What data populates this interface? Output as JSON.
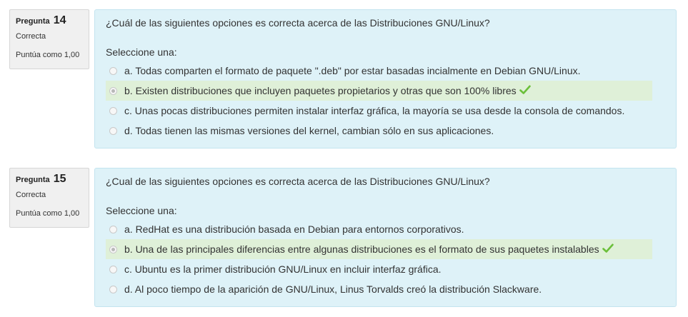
{
  "questions": [
    {
      "label": "Pregunta",
      "number": "14",
      "state": "Correcta",
      "grade": "Puntúa como 1,00",
      "text": "¿Cuál de las siguientes opciones es correcta acerca de las Distribuciones GNU/Linux?",
      "prompt": "Seleccione una:",
      "answers": [
        {
          "label": "a. Todas comparten el formato de paquete \".deb\" por estar basadas incialmente en Debian GNU/Linux."
        },
        {
          "label": "b. Existen distribuciones que incluyen paquetes propietarios y otras que son 100% libres",
          "selected": true,
          "correct": true
        },
        {
          "label": "c. Unas pocas distribuciones permiten instalar interfaz gráfica, la mayoría se usa desde la consola de comandos."
        },
        {
          "label": "d. Todas tienen las mismas versiones del kernel, cambian sólo en sus aplicaciones."
        }
      ]
    },
    {
      "label": "Pregunta",
      "number": "15",
      "state": "Correcta",
      "grade": "Puntúa como 1,00",
      "text": "¿Cual de las siguientes opciones es correcta acerca de las Distribuciones GNU/Linux?",
      "prompt": "Seleccione una:",
      "answers": [
        {
          "label": "a. RedHat es una distribución basada en Debian para entornos corporativos."
        },
        {
          "label": "b. Una de las principales diferencias entre algunas distribuciones es el formato de sus paquetes instalables",
          "selected": true,
          "correct": true
        },
        {
          "label": "c. Ubuntu es la primer distribución GNU/Linux en incluir interfaz gráfica."
        },
        {
          "label": "d. Al poco tiempo de la aparición de GNU/Linux, Linus Torvalds creó la distribución Slackware."
        }
      ]
    }
  ],
  "icons": {
    "correct": "checkmark-icon"
  },
  "colors": {
    "content_bg": "#def2f8",
    "correct_bg": "#dff0d8",
    "check": "#6bbf3a"
  }
}
